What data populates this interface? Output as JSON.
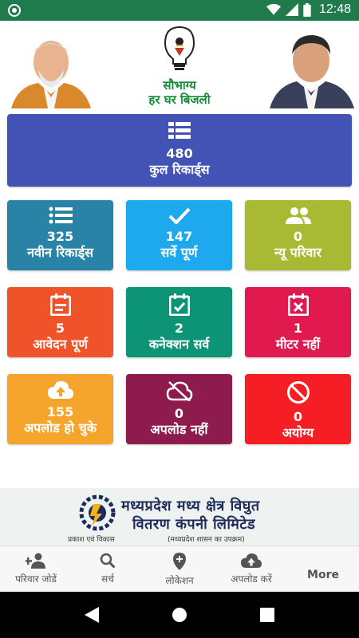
{
  "status_bar": {
    "time": "12:48",
    "icons": [
      "target-icon",
      "wifi-icon",
      "signal-icon",
      "battery-icon"
    ]
  },
  "header": {
    "logo_tag_line1": "सौभाग्य",
    "logo_tag_line2": "हर घर बिजली"
  },
  "total": {
    "count": "480",
    "label": "कुल रिकार्ड्स",
    "icon": "list-icon",
    "color": "#4353b5"
  },
  "cards": [
    {
      "count": "325",
      "label": "नवीन रिकार्ड्स",
      "icon": "list-icon",
      "color": "#2983a6"
    },
    {
      "count": "147",
      "label": "सर्वे पूर्ण",
      "icon": "check-icon",
      "color": "#1ea9ef"
    },
    {
      "count": "0",
      "label": "न्यू परिवार",
      "icon": "people-icon",
      "color": "#a8ba34"
    },
    {
      "count": "5",
      "label": "आवेदन पूर्ण",
      "icon": "calendar-icon",
      "color": "#f0532a"
    },
    {
      "count": "2",
      "label": "कनेक्शन सर्व",
      "icon": "calendar-check-icon",
      "color": "#0d9477"
    },
    {
      "count": "1",
      "label": "मीटर नहीं",
      "icon": "calendar-x-icon",
      "color": "#e0194f"
    },
    {
      "count": "155",
      "label": "अपलोड हो चुके",
      "icon": "cloud-upload-icon",
      "color": "#f5a52c"
    },
    {
      "count": "0",
      "label": "अपलोड नहीं",
      "icon": "cloud-off-icon",
      "color": "#8d1b4e"
    },
    {
      "count": "0",
      "label": "अयोग्य",
      "icon": "block-icon",
      "color": "#f51e24"
    }
  ],
  "banner": {
    "line1": "मध्यप्रदेश मध्य क्षेत्र विघुत",
    "line2": "वितरण कंपनी लिमिटेड",
    "sub_left": "प्रकाश एवं विकास",
    "sub_right": "(मध्यप्रदेश शासन का उपक्रम)"
  },
  "bottom_nav": [
    {
      "label": "परिवार जोडें",
      "icon": "add-person-icon"
    },
    {
      "label": "सर्च",
      "icon": "search-icon"
    },
    {
      "label": "लोकेशन",
      "icon": "location-icon"
    },
    {
      "label": "अपलोड करें",
      "icon": "cloud-upload-icon"
    },
    {
      "label": "More",
      "icon": ""
    }
  ]
}
